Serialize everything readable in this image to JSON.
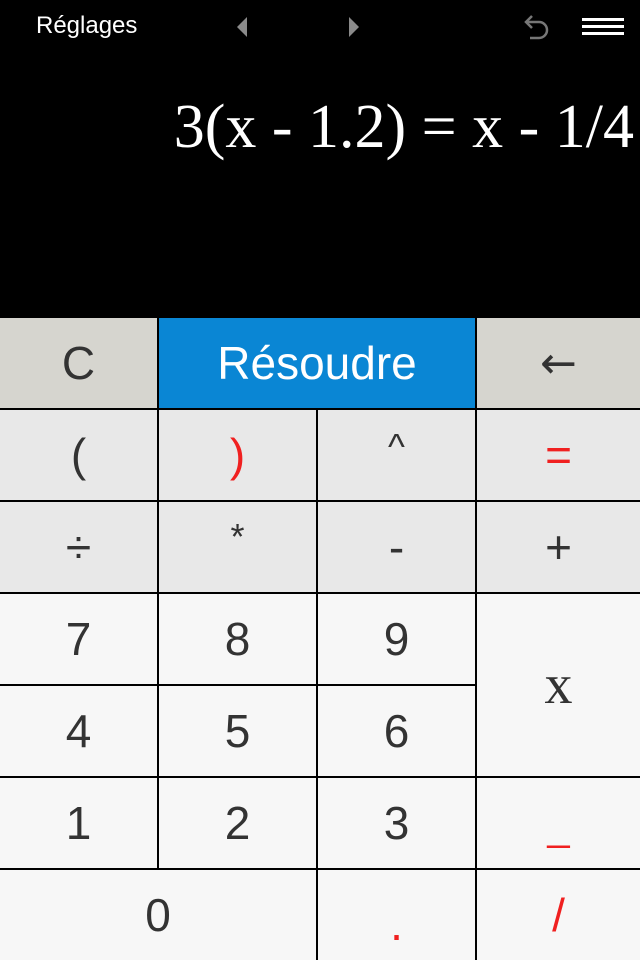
{
  "topbar": {
    "settings_label": "Réglages",
    "icons": [
      "chevron-left-icon",
      "chevron-right-icon",
      "undo-icon",
      "menu-icon"
    ]
  },
  "display": {
    "equation": "3(x - 1.2) = x - 1/4"
  },
  "keypad": {
    "clear": "C",
    "solve": "Résoudre",
    "backspace": "←",
    "open_paren": "(",
    "close_paren": ")",
    "power": "^",
    "equals": "=",
    "divide": "÷",
    "multiply": "*",
    "minus": "-",
    "plus": "+",
    "seven": "7",
    "eight": "8",
    "nine": "9",
    "variable": "x",
    "four": "4",
    "five": "5",
    "six": "6",
    "one": "1",
    "two": "2",
    "three": "3",
    "underscore": "_",
    "zero": "0",
    "decimal": ".",
    "fraction": "/"
  },
  "colors": {
    "solve_button": "#0a86d4",
    "operator_red": "#f02020",
    "clear_row_bg": "#d6d5cf",
    "operator_row_bg": "#e8e8e8",
    "digit_bg": "#f7f7f7"
  }
}
